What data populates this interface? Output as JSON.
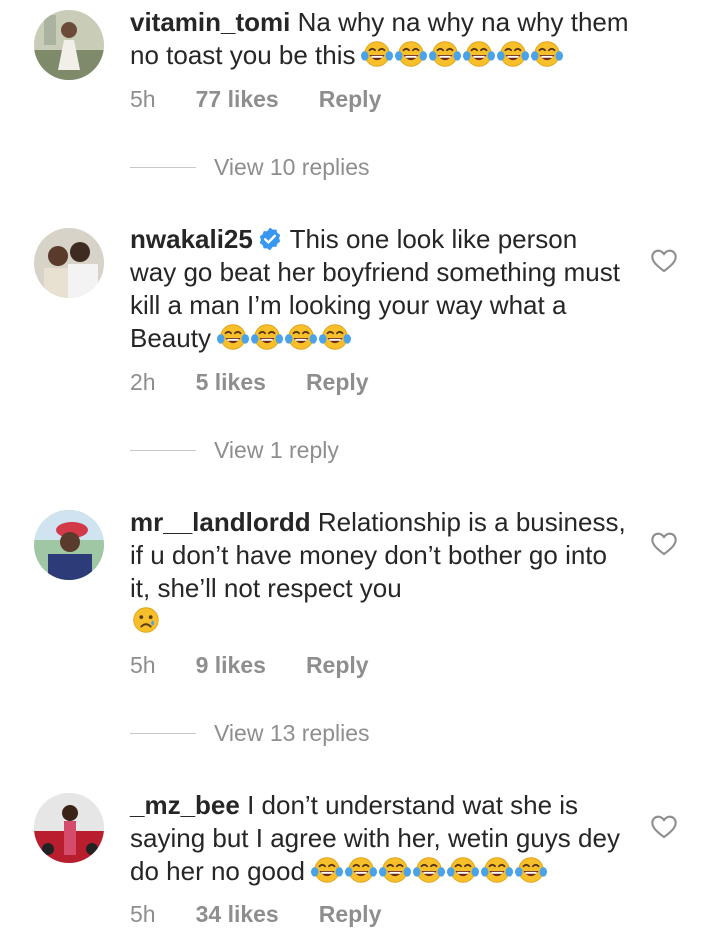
{
  "comments": [
    {
      "username": "vitamin_tomi",
      "verified": false,
      "text": "Na why na why na why them no toast you be this",
      "emoji_count": 6,
      "emoji_type": "laughing-crying",
      "time": "5h",
      "likes": "77 likes",
      "reply": "Reply",
      "view_replies": "View 10 replies",
      "has_heart": false
    },
    {
      "username": "nwakali25",
      "verified": true,
      "text": "This one look like person way go beat her boyfriend something must kill a man I’m looking your way what a Beauty",
      "emoji_count": 4,
      "emoji_type": "laughing-crying",
      "time": "2h",
      "likes": "5 likes",
      "reply": "Reply",
      "view_replies": "View 1 reply",
      "has_heart": true
    },
    {
      "username": "mr__landlordd",
      "verified": false,
      "text": "Relationship is a business, if u don’t have money don’t bother go into it, she’ll not respect you",
      "emoji_count": 1,
      "emoji_type": "crying",
      "time": "5h",
      "likes": "9 likes",
      "reply": "Reply",
      "view_replies": "View 13 replies",
      "has_heart": true
    },
    {
      "username": "_mz_bee",
      "verified": false,
      "text": "I don’t understand wat she is saying but I agree with her, wetin  guys dey do her no good",
      "emoji_count": 7,
      "emoji_type": "laughing-crying",
      "time": "5h",
      "likes": "34 likes",
      "reply": "Reply",
      "view_replies": "",
      "has_heart": true
    }
  ],
  "colors": {
    "text": "#262626",
    "muted": "#8e8e8e",
    "verified_blue": "#3897f0",
    "emoji_yellow": "#f7c02b"
  },
  "icons": [
    "verified-badge-icon",
    "heart-icon",
    "laughing-crying-emoji-icon",
    "crying-emoji-icon"
  ]
}
